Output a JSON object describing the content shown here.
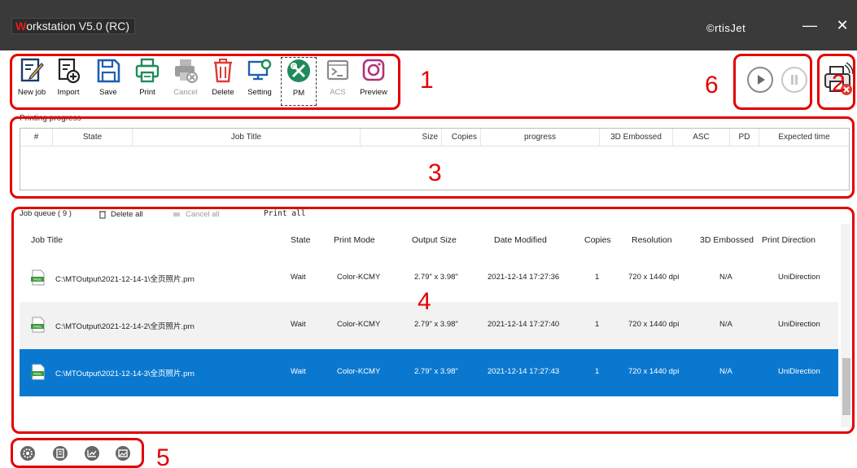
{
  "window": {
    "title_first_letter": "W",
    "title_rest": "orkstation V5.0 (RC)",
    "brand": "©rtisJet",
    "minimize_glyph": "—",
    "close_glyph": "✕"
  },
  "toolbar": {
    "buttons": [
      {
        "label": "New job",
        "icon": "new-job-icon",
        "enabled": true
      },
      {
        "label": "Import",
        "icon": "import-icon",
        "enabled": true
      },
      {
        "label": "Save",
        "icon": "save-icon",
        "enabled": true
      },
      {
        "label": "Print",
        "icon": "print-icon",
        "enabled": true
      },
      {
        "label": "Cancel",
        "icon": "cancel-print-icon",
        "enabled": false
      },
      {
        "label": "Delete",
        "icon": "trash-icon",
        "enabled": true
      },
      {
        "label": "Setting",
        "icon": "settings-monitor-icon",
        "enabled": true
      },
      {
        "label": "PM",
        "icon": "tools-icon",
        "enabled": true
      },
      {
        "label": "ACS",
        "icon": "terminal-icon",
        "enabled": false
      },
      {
        "label": "Preview",
        "icon": "preview-icon",
        "enabled": true
      }
    ]
  },
  "controls": {
    "play_icon": "play-icon",
    "pause_icon": "pause-icon",
    "printer_status_icon": "printer-offline-icon"
  },
  "annotations": [
    "1",
    "2",
    "3",
    "4",
    "5",
    "6"
  ],
  "printing_progress": {
    "caption": "Printing progress",
    "columns": [
      "#",
      "State",
      "Job Title",
      "Size",
      "Copies",
      "progress",
      "3D Embossed",
      "ASC",
      "PD",
      "Expected time"
    ]
  },
  "queue_bar": {
    "queue_label": "Job queue ( 9 )",
    "delete_all": "Delete all",
    "cancel_all": "Cancel all",
    "print_all": "Print all"
  },
  "job_queue": {
    "columns": [
      "Job Title",
      "State",
      "Print Mode",
      "Output Size",
      "Date Modified",
      "Copies",
      "Resolution",
      "3D Embossed",
      "Print Direction"
    ],
    "rows": [
      {
        "file_type": "PRN",
        "title": "C:\\MTOutput\\2021-12-14-1\\全页照片.prn",
        "state": "Wait",
        "print_mode": "Color-KCMY",
        "output_size": "2.79\" x 3.98\"",
        "date_modified": "2021-12-14 17:27:36",
        "copies": "1",
        "resolution": "720 x 1440 dpi",
        "embossed": "N/A",
        "direction": "UniDirection"
      },
      {
        "file_type": "PRN",
        "title": "C:\\MTOutput\\2021-12-14-2\\全页照片.prn",
        "state": "Wait",
        "print_mode": "Color-KCMY",
        "output_size": "2.79\" x 3.98\"",
        "date_modified": "2021-12-14 17:27:40",
        "copies": "1",
        "resolution": "720 x 1440 dpi",
        "embossed": "N/A",
        "direction": "UniDirection"
      },
      {
        "file_type": "PRN",
        "title": "C:\\MTOutput\\2021-12-14-3\\全页照片.prn",
        "state": "Wait",
        "print_mode": "Color-KCMY",
        "output_size": "2.79\" x 3.98\"",
        "date_modified": "2021-12-14 17:27:43",
        "copies": "1",
        "resolution": "720 x 1440 dpi",
        "embossed": "N/A",
        "direction": "UniDirection"
      }
    ]
  },
  "bottom_bar": {
    "icons": [
      "gear-icon",
      "document-icon",
      "chart-icon",
      "folder-image-icon"
    ]
  },
  "colors": {
    "titlebar": "#3a3a3a",
    "selection": "#0b78d0",
    "annotation": "#e30000",
    "accent_green": "#1f8a5a",
    "accent_red": "#e03a2f",
    "accent_blue": "#1f5fb0"
  }
}
